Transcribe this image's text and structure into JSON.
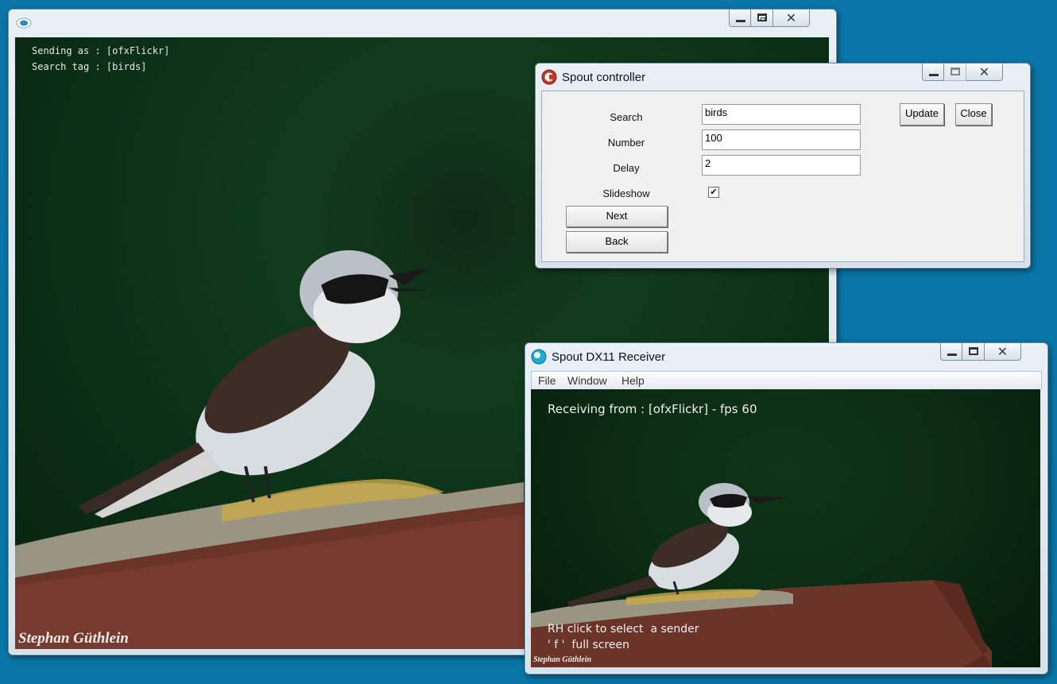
{
  "main_window": {
    "title": "",
    "sending_line": "Sending as : [ofxFlickr]",
    "search_line": "Search tag : [birds]",
    "signature": "Stephan Güthlein"
  },
  "controller": {
    "title": "Spout controller",
    "fields": {
      "search_label": "Search",
      "search_value": "birds",
      "number_label": "Number",
      "number_value": "100",
      "delay_label": "Delay",
      "delay_value": "2",
      "slideshow_label": "Slideshow",
      "slideshow_checked": "✔"
    },
    "buttons": {
      "update": "Update",
      "close": "Close",
      "next": "Next",
      "back": "Back"
    }
  },
  "receiver": {
    "title": "Spout DX11 Receiver",
    "menu": {
      "file": "File",
      "window": "Window",
      "help": "Help"
    },
    "status": "Receiving from : [ofxFlickr] - fps 60",
    "hint1": "RH click to select  a sender",
    "hint2": "' f '  full screen",
    "signature": "Stephan Güthlein"
  },
  "colors": {
    "desktop": "#0a76a8",
    "accent_red": "#c0392b",
    "accent_cyan": "#1ea9d0"
  }
}
